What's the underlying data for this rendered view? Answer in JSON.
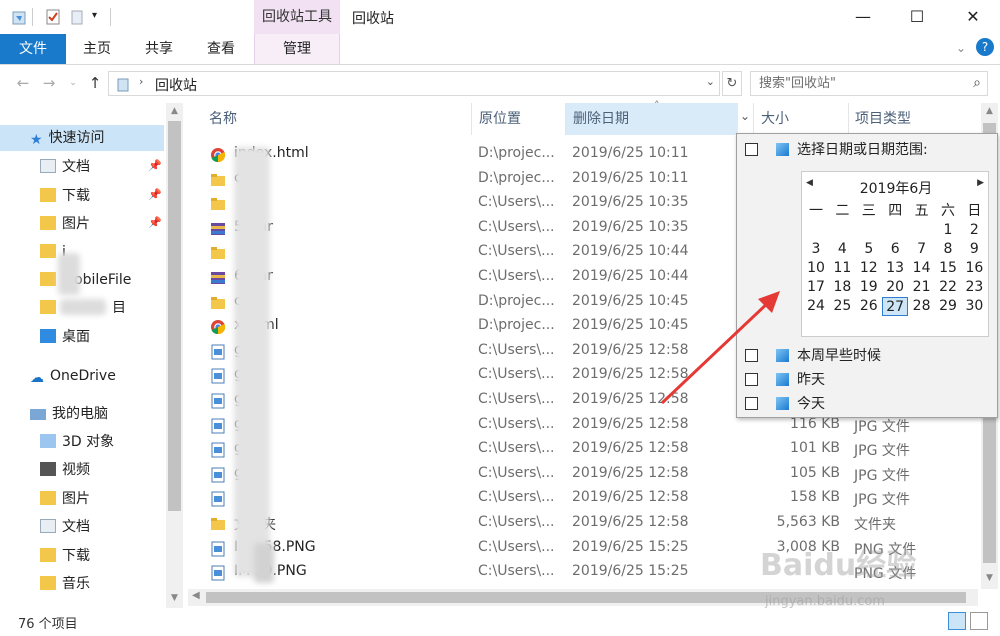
{
  "titlebar": {
    "context_tab": "回收站工具",
    "title": "回收站",
    "minimize": "—",
    "maximize": "☐",
    "close": "✕"
  },
  "ribbon": {
    "tabs": [
      "文件",
      "主页",
      "共享",
      "查看",
      "管理"
    ],
    "help": "?"
  },
  "address": {
    "path": "回收站",
    "search_placeholder": "搜索\"回收站\""
  },
  "nav": {
    "items": [
      {
        "label": "快速访问",
        "pinned": false
      },
      {
        "label": "文档",
        "pinned": true
      },
      {
        "label": "下载",
        "pinned": true
      },
      {
        "label": "图片",
        "pinned": true
      },
      {
        "label": "i",
        "pinned": false
      },
      {
        "label": "MobileFile",
        "pinned": false
      },
      {
        "label": "目",
        "pinned": false
      },
      {
        "label": "桌面",
        "pinned": false
      },
      {
        "label": "OneDrive",
        "pinned": false
      },
      {
        "label": "我的电脑",
        "pinned": false
      },
      {
        "label": "3D 对象",
        "pinned": false
      },
      {
        "label": "视频",
        "pinned": false
      },
      {
        "label": "图片",
        "pinned": false
      },
      {
        "label": "文档",
        "pinned": false
      },
      {
        "label": "下载",
        "pinned": false
      },
      {
        "label": "音乐",
        "pinned": false
      }
    ]
  },
  "columns": {
    "name": "名称",
    "location": "原位置",
    "deleted": "删除日期",
    "size": "大小",
    "type": "项目类型",
    "sort_indicator": "˄",
    "dropdown": "⌄"
  },
  "files": [
    {
      "name": "index.html",
      "icon": "chrome-icon",
      "location": "D:\\projec...",
      "date": "2019/6/25 10:11",
      "size": "",
      "type": ""
    },
    {
      "name": "c",
      "icon": "folder-icon",
      "location": "D:\\projec...",
      "date": "2019/6/25 10:11",
      "size": "",
      "type": ""
    },
    {
      "name": "",
      "icon": "folder-icon",
      "location": "C:\\Users\\...",
      "date": "2019/6/25 10:35",
      "size": "",
      "type": ""
    },
    {
      "name": "5).rar",
      "icon": "rar-icon",
      "location": "C:\\Users\\...",
      "date": "2019/6/25 10:35",
      "size": "",
      "type": ""
    },
    {
      "name": "",
      "icon": "folder-icon",
      "location": "C:\\Users\\...",
      "date": "2019/6/25 10:44",
      "size": "",
      "type": ""
    },
    {
      "name": "6).rar",
      "icon": "rar-icon",
      "location": "C:\\Users\\...",
      "date": "2019/6/25 10:44",
      "size": "",
      "type": ""
    },
    {
      "name": "c",
      "icon": "folder-icon",
      "location": "D:\\projec...",
      "date": "2019/6/25 10:45",
      "size": "",
      "type": ""
    },
    {
      "name": "x.html",
      "icon": "chrome-icon",
      "location": "D:\\projec...",
      "date": "2019/6/25 10:45",
      "size": "",
      "type": ""
    },
    {
      "name": "g",
      "icon": "image-icon",
      "location": "C:\\Users\\...",
      "date": "2019/6/25 12:58",
      "size": "",
      "type": ""
    },
    {
      "name": "g",
      "icon": "image-icon",
      "location": "C:\\Users\\...",
      "date": "2019/6/25 12:58",
      "size": "",
      "type": ""
    },
    {
      "name": "g",
      "icon": "image-icon",
      "location": "C:\\Users\\...",
      "date": "2019/6/25 12:58",
      "size": "",
      "type": ""
    },
    {
      "name": "g",
      "icon": "image-icon",
      "location": "C:\\Users\\...",
      "date": "2019/6/25 12:58",
      "size": "116 KB",
      "type": "JPG 文件"
    },
    {
      "name": "g",
      "icon": "image-icon",
      "location": "C:\\Users\\...",
      "date": "2019/6/25 12:58",
      "size": "101 KB",
      "type": "JPG 文件"
    },
    {
      "name": "g",
      "icon": "image-icon",
      "location": "C:\\Users\\...",
      "date": "2019/6/25 12:58",
      "size": "105 KB",
      "type": "JPG 文件"
    },
    {
      "name": "",
      "icon": "image-icon",
      "location": "C:\\Users\\...",
      "date": "2019/6/25 12:58",
      "size": "158 KB",
      "type": "JPG 文件"
    },
    {
      "name": "文件夹",
      "icon": "folder-icon",
      "location": "C:\\Users\\...",
      "date": "2019/6/25 12:58",
      "size": "5,563 KB",
      "type": "文件夹"
    },
    {
      "name": "IM  858.PNG",
      "icon": "image-icon",
      "location": "C:\\Users\\...",
      "date": "2019/6/25 15:25",
      "size": "3,008 KB",
      "type": "PNG 文件"
    },
    {
      "name": "IM  59.PNG",
      "icon": "image-icon",
      "location": "C:\\Users\\...",
      "date": "2019/6/25 15:25",
      "size": "",
      "type": "PNG 文件"
    }
  ],
  "filter": {
    "range_label": "选择日期或日期范围:",
    "month": "2019年6月",
    "weekdays": [
      "一",
      "二",
      "三",
      "四",
      "五",
      "六",
      "日"
    ],
    "first_weekday_index": 5,
    "days_in_month": 30,
    "selected_day": 27,
    "options": [
      "本周早些时候",
      "昨天",
      "今天"
    ]
  },
  "status": {
    "count": "76 个项目"
  },
  "watermark": {
    "brand": "Baidu经验",
    "url": "jingyan.baidu.com"
  },
  "colors": {
    "file_tab": "#1979ca",
    "context_tab": "#f1e1f3",
    "selection": "#cce4f7",
    "arrow": "#e53935"
  }
}
